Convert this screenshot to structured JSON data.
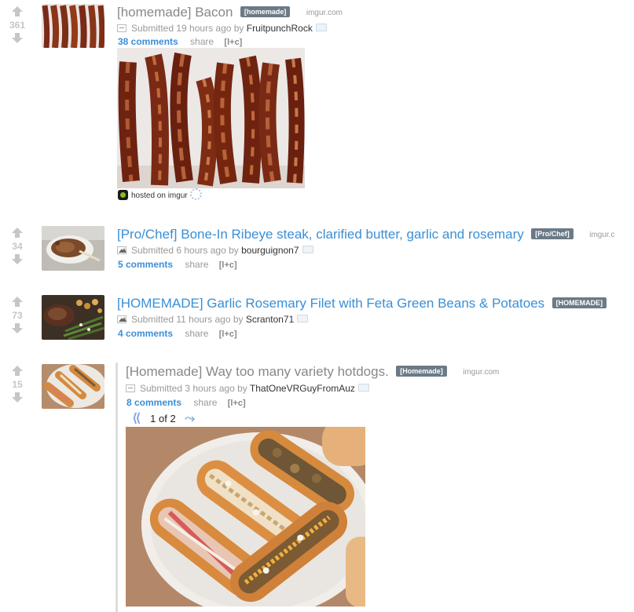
{
  "posts": [
    {
      "score": "361",
      "title": "[homemade] Bacon",
      "flair": "[homemade]",
      "domain": "imgur.com",
      "submitted": "Submitted 19 hours ago by",
      "author": "FruitpunchRock",
      "comments": "38 comments",
      "share": "share",
      "lc": "[l+c]",
      "hosted": "hosted on imgur"
    },
    {
      "score": "34",
      "title": "[Pro/Chef] Bone-In Ribeye steak, clarified butter, garlic and rosemary",
      "flair": "[Pro/Chef]",
      "domain": "imgur.c",
      "submitted": "Submitted 6 hours ago by",
      "author": "bourguignon7",
      "comments": "5 comments",
      "share": "share",
      "lc": "[l+c]"
    },
    {
      "score": "73",
      "title": "[HOMEMADE] Garlic Rosemary Filet with Feta Green Beans & Potatoes",
      "flair": "[HOMEMADE]",
      "submitted": "Submitted 11 hours ago by",
      "author": "Scranton71",
      "comments": "4 comments",
      "share": "share",
      "lc": "[l+c]"
    },
    {
      "score": "15",
      "title": "[Homemade] Way too many variety hotdogs.",
      "flair": "[Homemade]",
      "domain": "imgur.com",
      "submitted": "Submitted 3 hours ago by",
      "author": "ThatOneVRGuyFromAuz",
      "comments": "8 comments",
      "share": "share",
      "lc": "[l+c]",
      "gallery_position": "1 of 2"
    }
  ],
  "colors": {
    "link_blue": "#3a8fd6",
    "visited_gray": "#888888",
    "flair_bg": "#6b7a86",
    "vote_gray": "#c6c6c6"
  },
  "icons": [
    "upvote-arrow-icon",
    "downvote-arrow-icon",
    "collapse-expando-icon",
    "image-expando-icon",
    "save-icon",
    "imgur-logo-icon",
    "gear-icon",
    "prev-arrow-icon",
    "next-arrow-icon"
  ]
}
